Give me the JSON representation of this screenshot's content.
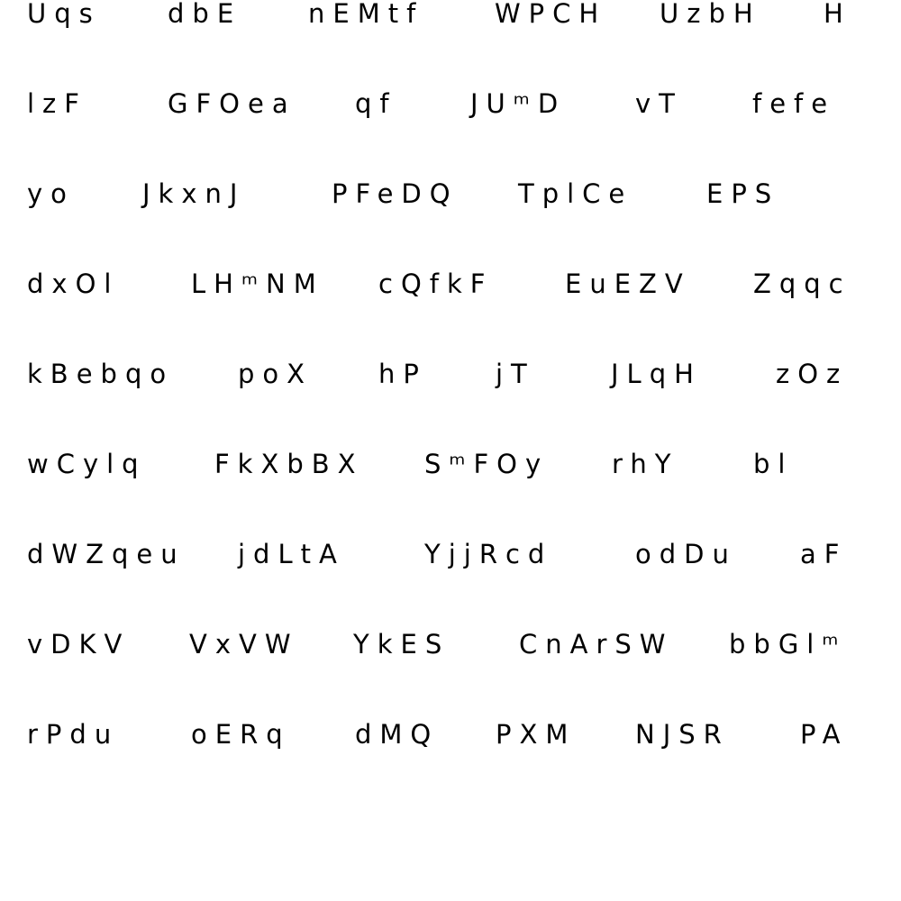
{
  "text_color": "#000000",
  "background_color": "#ffffff",
  "rows": [
    [
      "Uqs",
      "dbE",
      "nEMtf",
      "WPCH",
      "UzbH",
      "H"
    ],
    [
      "lzF",
      "GFOea",
      "qf",
      "JUᵐD",
      "vT",
      "fefe"
    ],
    [
      "yo",
      "JkxnJ",
      "PFeDQ",
      "TplCe",
      "EPS"
    ],
    [
      "dxOl",
      "LHᵐNM",
      "cQfkF",
      "EuEZV",
      "Zqqc"
    ],
    [
      "kBebqo",
      "poX",
      "hP",
      "jT",
      "JLqH",
      "zOz"
    ],
    [
      "wCylq",
      "FkXbBX",
      "SᵐFOy",
      "rhY",
      "bl"
    ],
    [
      "dWZqeu",
      "jdLtA",
      "YjjRcd",
      "odDu",
      "aF"
    ],
    [
      "vDKV",
      "VxVW",
      "YkES",
      "CnArSW",
      "bbGlᵐ"
    ],
    [
      "rPdu",
      "oERq",
      "dMQ",
      "PXM",
      "NJSR",
      "PA"
    ]
  ]
}
